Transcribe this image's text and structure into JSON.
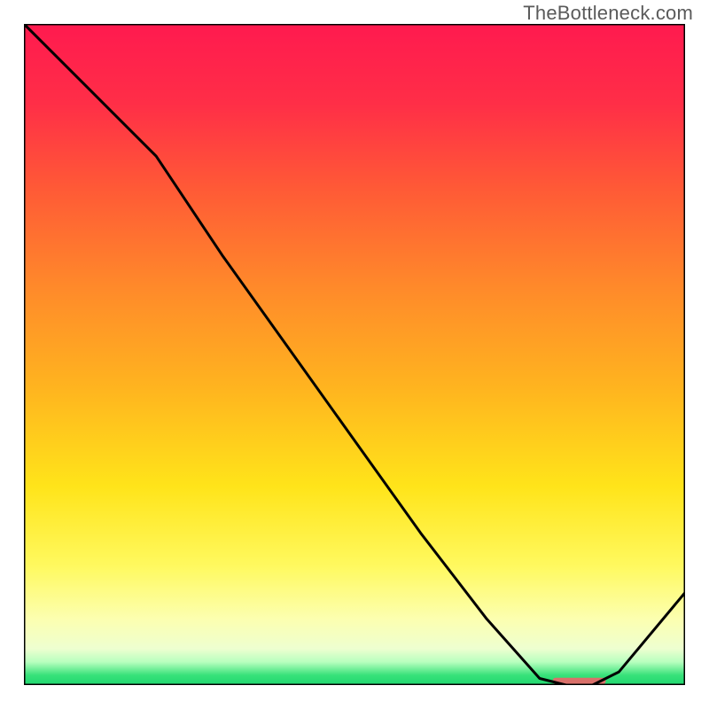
{
  "watermark": "TheBottleneck.com",
  "chart_data": {
    "type": "line",
    "title": "",
    "xlabel": "",
    "ylabel": "",
    "xlim": [
      0,
      100
    ],
    "ylim": [
      0,
      100
    ],
    "grid": false,
    "legend": false,
    "x": [
      0,
      10,
      20,
      30,
      40,
      50,
      60,
      70,
      78,
      82,
      86,
      90,
      100
    ],
    "values": [
      100,
      90,
      80,
      65,
      51,
      37,
      23,
      10,
      1,
      0,
      0,
      2,
      14
    ],
    "optimal_band": {
      "x_start": 80,
      "x_end": 88,
      "y": 0.7
    },
    "gradient_stops": [
      {
        "offset": 0.0,
        "color": "#ff1a4f"
      },
      {
        "offset": 0.12,
        "color": "#ff2e47"
      },
      {
        "offset": 0.25,
        "color": "#ff5a36"
      },
      {
        "offset": 0.4,
        "color": "#ff8a2a"
      },
      {
        "offset": 0.55,
        "color": "#ffb41f"
      },
      {
        "offset": 0.7,
        "color": "#ffe41a"
      },
      {
        "offset": 0.82,
        "color": "#fff95f"
      },
      {
        "offset": 0.9,
        "color": "#fcffb0"
      },
      {
        "offset": 0.945,
        "color": "#eeffd0"
      },
      {
        "offset": 0.965,
        "color": "#b8ffbf"
      },
      {
        "offset": 0.985,
        "color": "#38e27a"
      },
      {
        "offset": 1.0,
        "color": "#1fd66e"
      }
    ],
    "line_color": "#000000",
    "optimal_band_color": "#d9706a",
    "border_color": "#000000"
  }
}
